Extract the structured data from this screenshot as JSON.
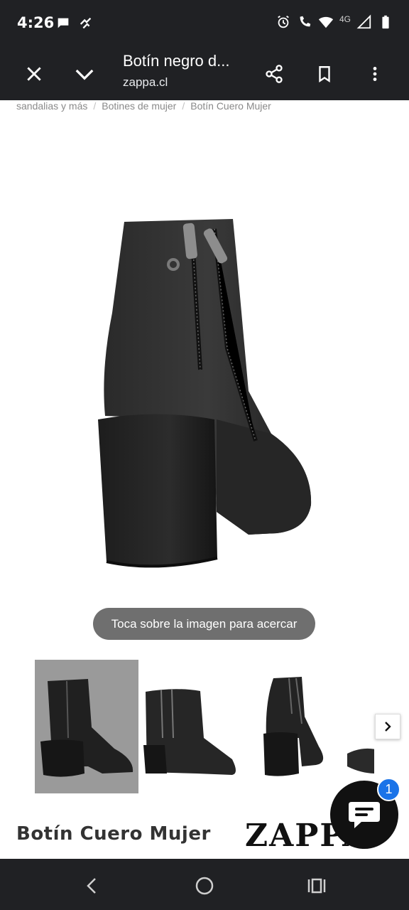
{
  "status_bar": {
    "time": "4:26",
    "network": "4G",
    "icons": [
      "chat-bubble-icon",
      "vpn-icon",
      "alarm-icon",
      "wifi-calling-icon",
      "wifi-icon",
      "signal-icon",
      "battery-icon"
    ]
  },
  "toolbar": {
    "title": "Botín negro d...",
    "url": "zappa.cl",
    "icons": [
      "close-icon",
      "chevron-down-icon",
      "share-icon",
      "bookmark-icon",
      "more-vert-icon"
    ]
  },
  "breadcrumb": {
    "items": [
      "sandalias y más",
      "Botines de mujer",
      "Botín Cuero Mujer"
    ],
    "separator": "/"
  },
  "zoom_hint": "Toca sobre la imagen para acercar",
  "product": {
    "title": "Botín Cuero Mujer",
    "brand": "ZAPPA"
  },
  "chat": {
    "badge_count": "1"
  },
  "colors": {
    "bar_bg": "#202124",
    "badge_blue": "#1a73e8",
    "active_thumb_bg": "#9a9a9a"
  }
}
